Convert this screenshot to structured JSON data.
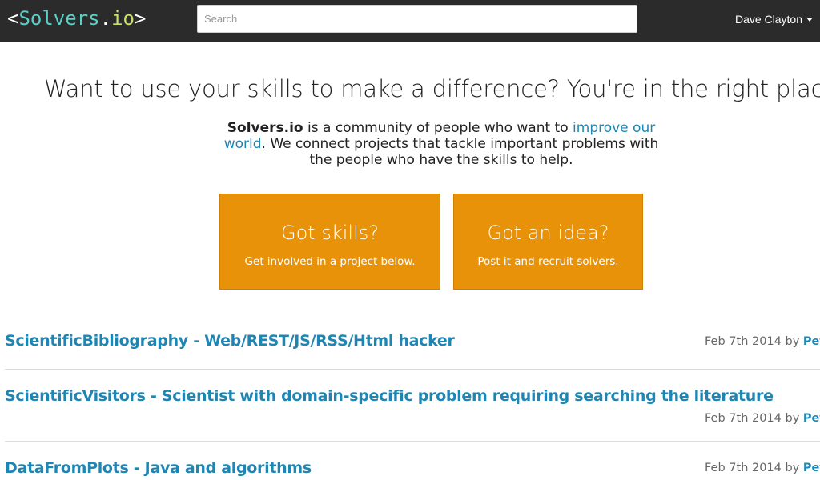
{
  "navbar": {
    "logo": {
      "open_bracket": "<",
      "name": "Solvers",
      "dot": ".",
      "tld": "io",
      "close_bracket": ">"
    },
    "search": {
      "placeholder": "Search",
      "value": ""
    },
    "user": {
      "name": "Dave Clayton"
    }
  },
  "hero": {
    "headline": "Want to use your skills to make a difference? You're in the right place",
    "intro": {
      "brand": "Solvers.io",
      "text_1": " is a community of people who want to ",
      "link_text": "improve our world",
      "text_2": ". We connect projects that tackle important problems with the people who have the skills to help."
    }
  },
  "cta": [
    {
      "title": "Got skills?",
      "subtitle": "Get involved in a project below."
    },
    {
      "title": "Got an idea?",
      "subtitle": "Post it and recruit solvers."
    }
  ],
  "projects": [
    {
      "title": "ScientificBibliography - Web/REST/JS/RSS/Html hacker",
      "date": "Feb 7th 2014",
      "by": "by",
      "author": "Pete"
    },
    {
      "title": "ScientificVisitors - Scientist with domain-specific problem requiring searching the literature",
      "date": "Feb 7th 2014",
      "by": "by",
      "author": "Pete"
    },
    {
      "title": "DataFromPlots - Java and algorithms",
      "date": "Feb 7th 2014",
      "by": "by",
      "author": "Pete"
    }
  ],
  "colors": {
    "navbar_bg": "#2b2b2b",
    "accent_orange": "#e8920a",
    "link_blue": "#1f86b3",
    "logo_teal": "#5bd0c9",
    "logo_lime": "#c8e06a"
  }
}
